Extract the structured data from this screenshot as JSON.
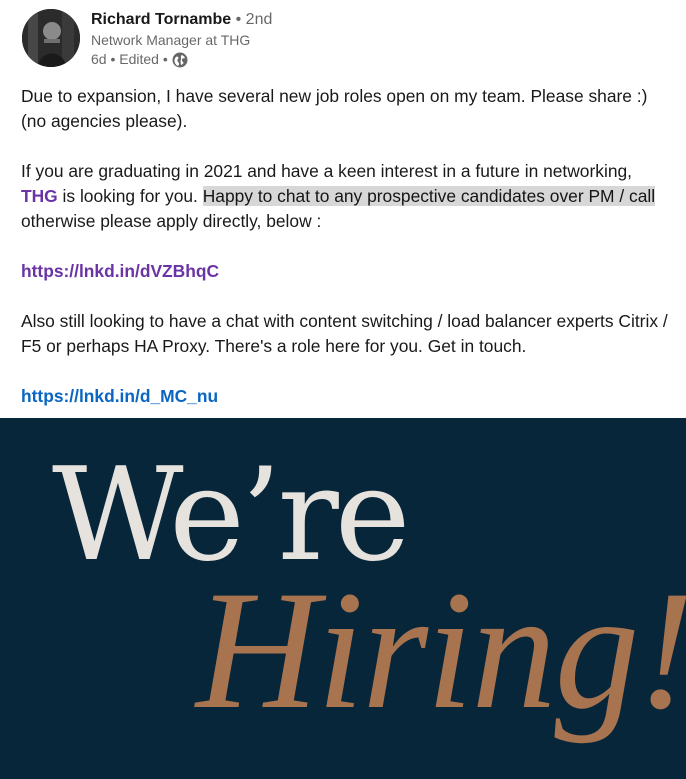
{
  "actor": {
    "name": "Richard Tornambe",
    "degree": " • 2nd",
    "headline": "Network Manager at THG",
    "time_meta": "6d • Edited •",
    "visibility_icon": "globe-icon"
  },
  "post": {
    "para1": "Due to expansion, I have several new job roles open on my team. Please share :) (no agencies please).",
    "para2_before": "If you are graduating in 2021 and have a keen interest in a future in networking,",
    "para2_tag": "THG",
    "para2_mid": " is looking for you. ",
    "para2_highlight": "Happy to chat to any prospective candidates over PM / call",
    "para2_after": "otherwise please apply directly, below :",
    "link1": "https://lnkd.in/dVZBhqC",
    "para3": "Also still looking to have a chat with content switching / load balancer experts Citrix / F5 or perhaps HA Proxy. There's a role here for you. Get in touch.",
    "link2": "https://lnkd.in/d_MC_nu"
  },
  "image": {
    "line1": "We’re",
    "line2": "Hiring!",
    "background_color": "#08263a",
    "line1_color": "#e6e2dd",
    "line2_color": "#a8734f"
  }
}
